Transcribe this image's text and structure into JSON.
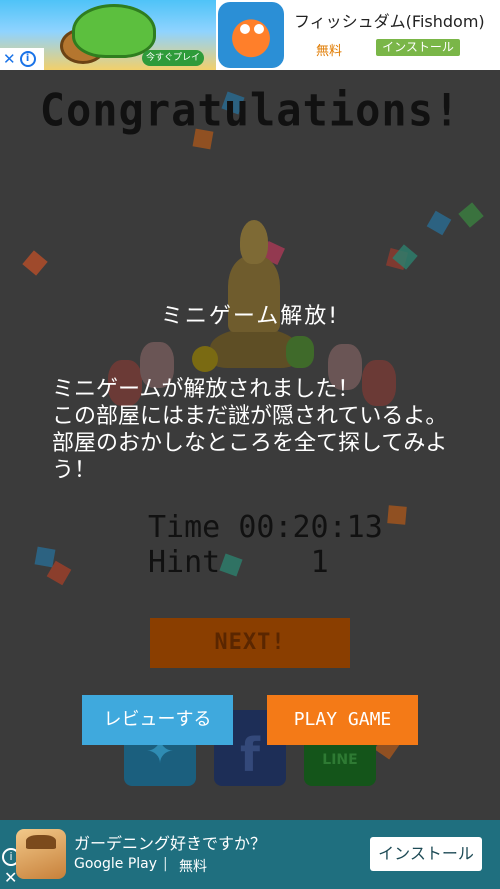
{
  "ad_top": {
    "play_now_label": "今すぐプレイ",
    "app_title": "フィッシュダム(Fishdom)",
    "price": "無料",
    "install_label": "インストール",
    "close_glyph": "✕",
    "info_glyph": "i"
  },
  "game": {
    "congratulations": "Congratulations!",
    "dialog_title": "ミニゲーム解放!",
    "dialog_body": "ミニゲームが解放されました！\nこの部屋にはまだ謎が隠されているよ。\n部屋のおかしなところを全て探してみよう！",
    "time_label": "Time",
    "time_value": "00:20:13",
    "hint_label": "Hint",
    "hint_value": "1",
    "next_label": "NEXT!",
    "review_label": "レビューする",
    "play_game_label": "PLAY GAME",
    "share_line_label": "LINE",
    "share_facebook_glyph": "f",
    "share_twitter_glyph": "✦"
  },
  "ad_bottom": {
    "title": "ガーデニング好きですか？",
    "store": "Google Play",
    "separator": "|",
    "price": "無料",
    "install_label": "インストール",
    "info_glyph": "i",
    "close_glyph": "✕"
  },
  "colors": {
    "background": "#3b3b3b",
    "review_button": "#3fa9dd",
    "play_game_button": "#f47a17",
    "next_button": "#8a3e00",
    "bottom_ad": "#1f6f7f"
  }
}
